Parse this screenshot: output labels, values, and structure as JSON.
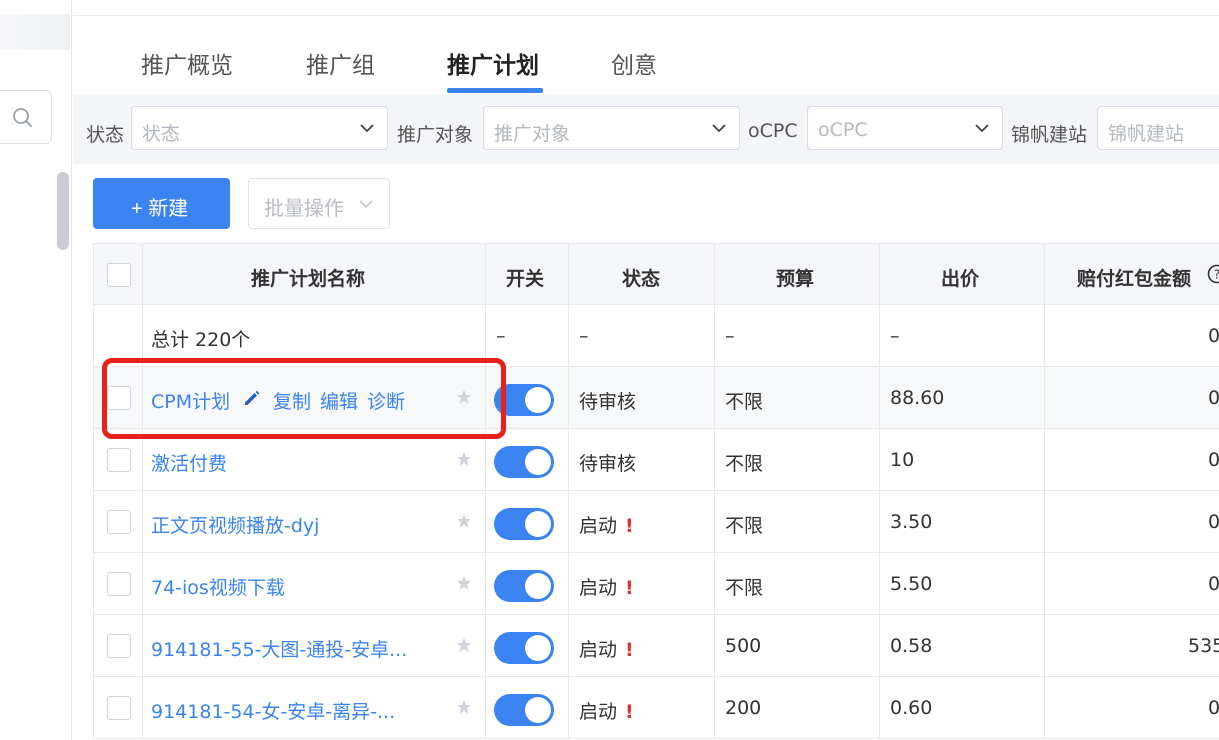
{
  "tabs": [
    {
      "label": "推广概览",
      "active": false
    },
    {
      "label": "推广组",
      "active": false
    },
    {
      "label": "推广计划",
      "active": true
    },
    {
      "label": "创意",
      "active": false
    }
  ],
  "filters": [
    {
      "label": "状态",
      "placeholder": "状态"
    },
    {
      "label": "推广对象",
      "placeholder": "推广对象"
    },
    {
      "label": "oCPC",
      "placeholder": "oCPC"
    },
    {
      "label": "锦帆建站",
      "placeholder": "锦帆建站"
    }
  ],
  "toolbar": {
    "new_label": "+ 新建",
    "batch_label": "批量操作"
  },
  "table": {
    "headers": [
      "推广计划名称",
      "开关",
      "状态",
      "预算",
      "出价",
      "赔付红包金额"
    ],
    "total": {
      "label": "总计 220个",
      "switch": "–",
      "status": "–",
      "budget": "–",
      "bid": "–",
      "compensation": "0"
    },
    "rows": [
      {
        "name": "CPM计划",
        "actions": [
          "复制",
          "编辑",
          "诊断"
        ],
        "switch_on": true,
        "status": "待审核",
        "warning": false,
        "budget": "不限",
        "bid": "88.60",
        "compensation": "0"
      },
      {
        "name": "激活付费",
        "switch_on": true,
        "status": "待审核",
        "warning": false,
        "budget": "不限",
        "bid": "10",
        "compensation": "0"
      },
      {
        "name": "正文页视频播放-dyj",
        "switch_on": true,
        "status": "启动",
        "warning": true,
        "budget": "不限",
        "bid": "3.50",
        "compensation": "0"
      },
      {
        "name": "74-ios视频下载",
        "switch_on": true,
        "status": "启动",
        "warning": true,
        "budget": "不限",
        "bid": "5.50",
        "compensation": "0"
      },
      {
        "name": "914181-55-大图-通投-安卓...",
        "switch_on": true,
        "status": "启动",
        "warning": true,
        "budget": "500",
        "bid": "0.58",
        "compensation": "535"
      },
      {
        "name": "914181-54-女-安卓-离异-...",
        "switch_on": true,
        "status": "启动",
        "warning": true,
        "budget": "200",
        "bid": "0.60",
        "compensation": "0"
      }
    ]
  },
  "colors": {
    "accent": "#3a83f1",
    "highlight_border": "#e8211b",
    "warning": "#e23131"
  }
}
